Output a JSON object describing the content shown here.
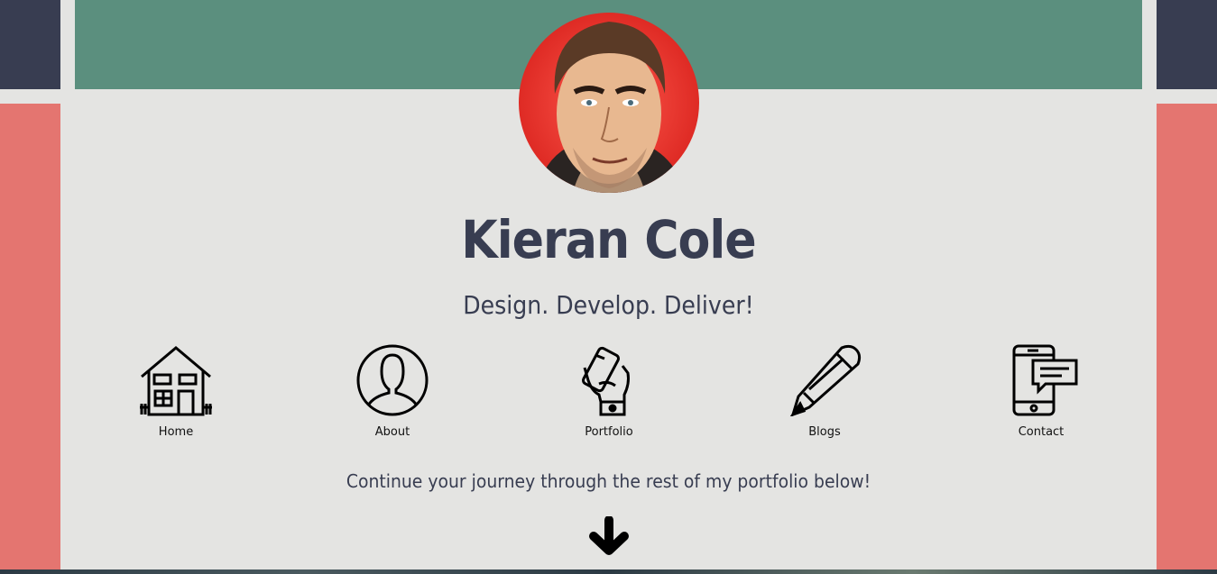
{
  "profile": {
    "name": "Kieran Cole",
    "tagline": "Design. Develop. Deliver!",
    "avatar_icon": "profile-avatar"
  },
  "nav": [
    {
      "label": "Home",
      "icon": "house-icon"
    },
    {
      "label": "About",
      "icon": "person-icon"
    },
    {
      "label": "Portfolio",
      "icon": "phone-in-hand-icon"
    },
    {
      "label": "Blogs",
      "icon": "pencil-icon"
    },
    {
      "label": "Contact",
      "icon": "phone-message-icon"
    }
  ],
  "continue_text": "Continue your journey through the rest of my portfolio below!",
  "scroll_icon": "arrow-down-icon",
  "colors": {
    "background": "#e4e4e2",
    "banner": "#5b8f7e",
    "navy": "#383d51",
    "coral": "#e47570"
  }
}
